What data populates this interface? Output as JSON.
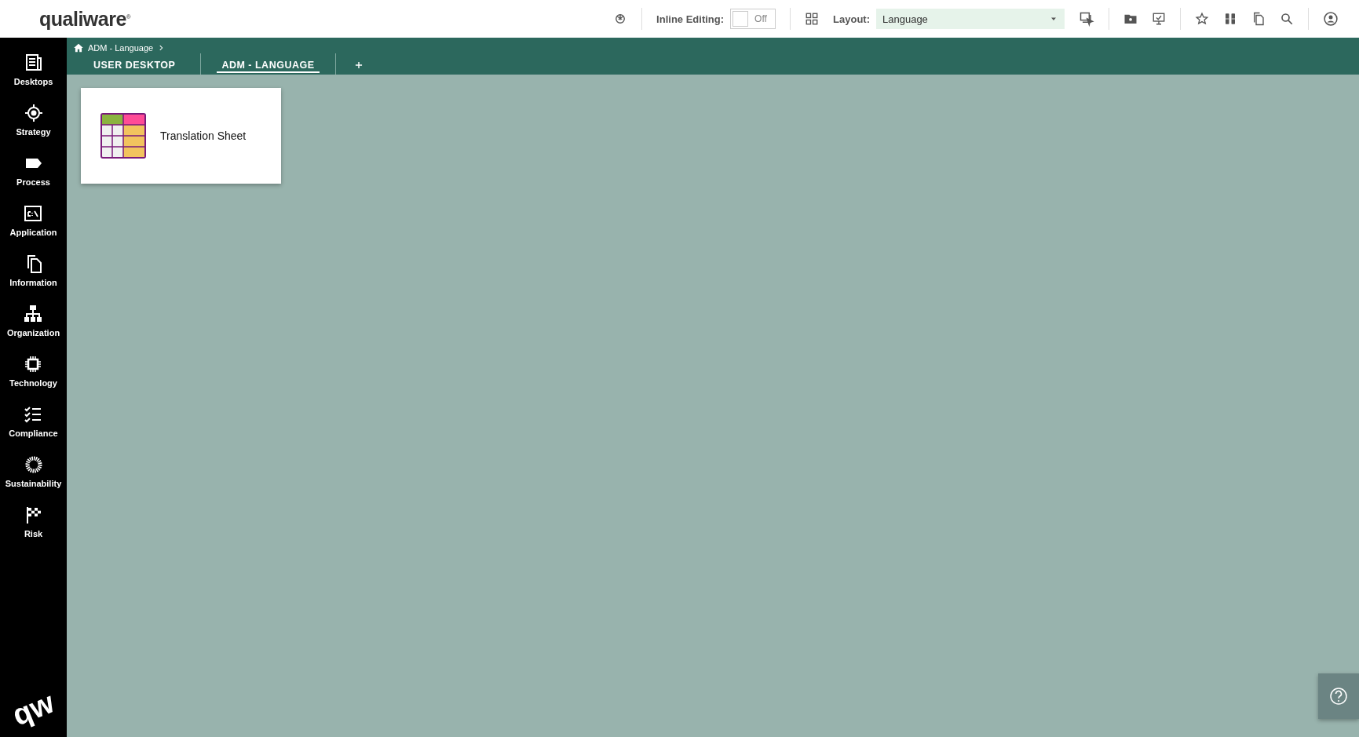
{
  "header": {
    "logo": "qualiware$^{®}$",
    "inline_editing": {
      "label": "Inline Editing:",
      "on": false,
      "state_text": "Off"
    },
    "layout": {
      "label": "Layout:",
      "value": "Language"
    }
  },
  "sidebar": {
    "items": [
      {
        "label": "Desktops",
        "kind": "desktops"
      },
      {
        "label": "Strategy",
        "kind": "strategy"
      },
      {
        "label": "Process",
        "kind": "process"
      },
      {
        "label": "Application",
        "kind": "application"
      },
      {
        "label": "Information",
        "kind": "information"
      },
      {
        "label": "Organization",
        "kind": "organization"
      },
      {
        "label": "Technology",
        "kind": "technology"
      },
      {
        "label": "Compliance",
        "kind": "compliance"
      },
      {
        "label": "Sustainability",
        "kind": "sustainability"
      },
      {
        "label": "Risk",
        "kind": "risk"
      }
    ],
    "logo": "qw"
  },
  "breadcrumb": [
    "ADM - Language"
  ],
  "tabs": [
    {
      "label": "USER DESKTOP",
      "selected": false
    },
    {
      "label": "ADM - LANGUAGE",
      "selected": true
    }
  ],
  "tiles": [
    {
      "label": "Translation Sheet"
    }
  ]
}
